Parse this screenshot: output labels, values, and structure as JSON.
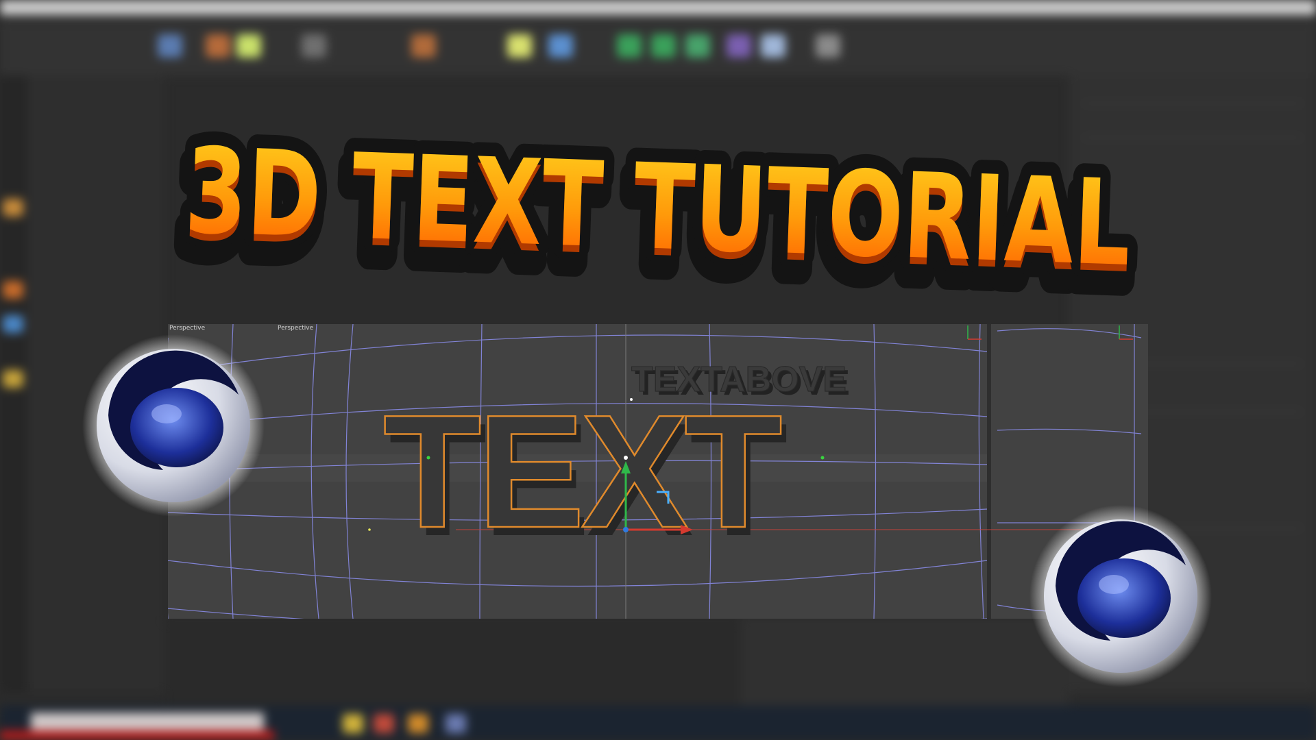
{
  "thumbnail": {
    "title": "3D TEXT TUTORIAL",
    "title_colors": {
      "top": "#ffd21e",
      "bottom": "#ff5a00",
      "outline": "#141414"
    }
  },
  "viewport": {
    "left_view_label": "Perspective",
    "right_view_label": "Perspective",
    "scene_text_main": "TEXT",
    "scene_text_above": "TEXTABOVE",
    "selection_color": "#e08a2c",
    "grid_color": "#8d8ff0"
  },
  "logos": [
    {
      "icon": "cinema4d-logo-icon"
    },
    {
      "icon": "cinema4d-logo-icon"
    }
  ]
}
